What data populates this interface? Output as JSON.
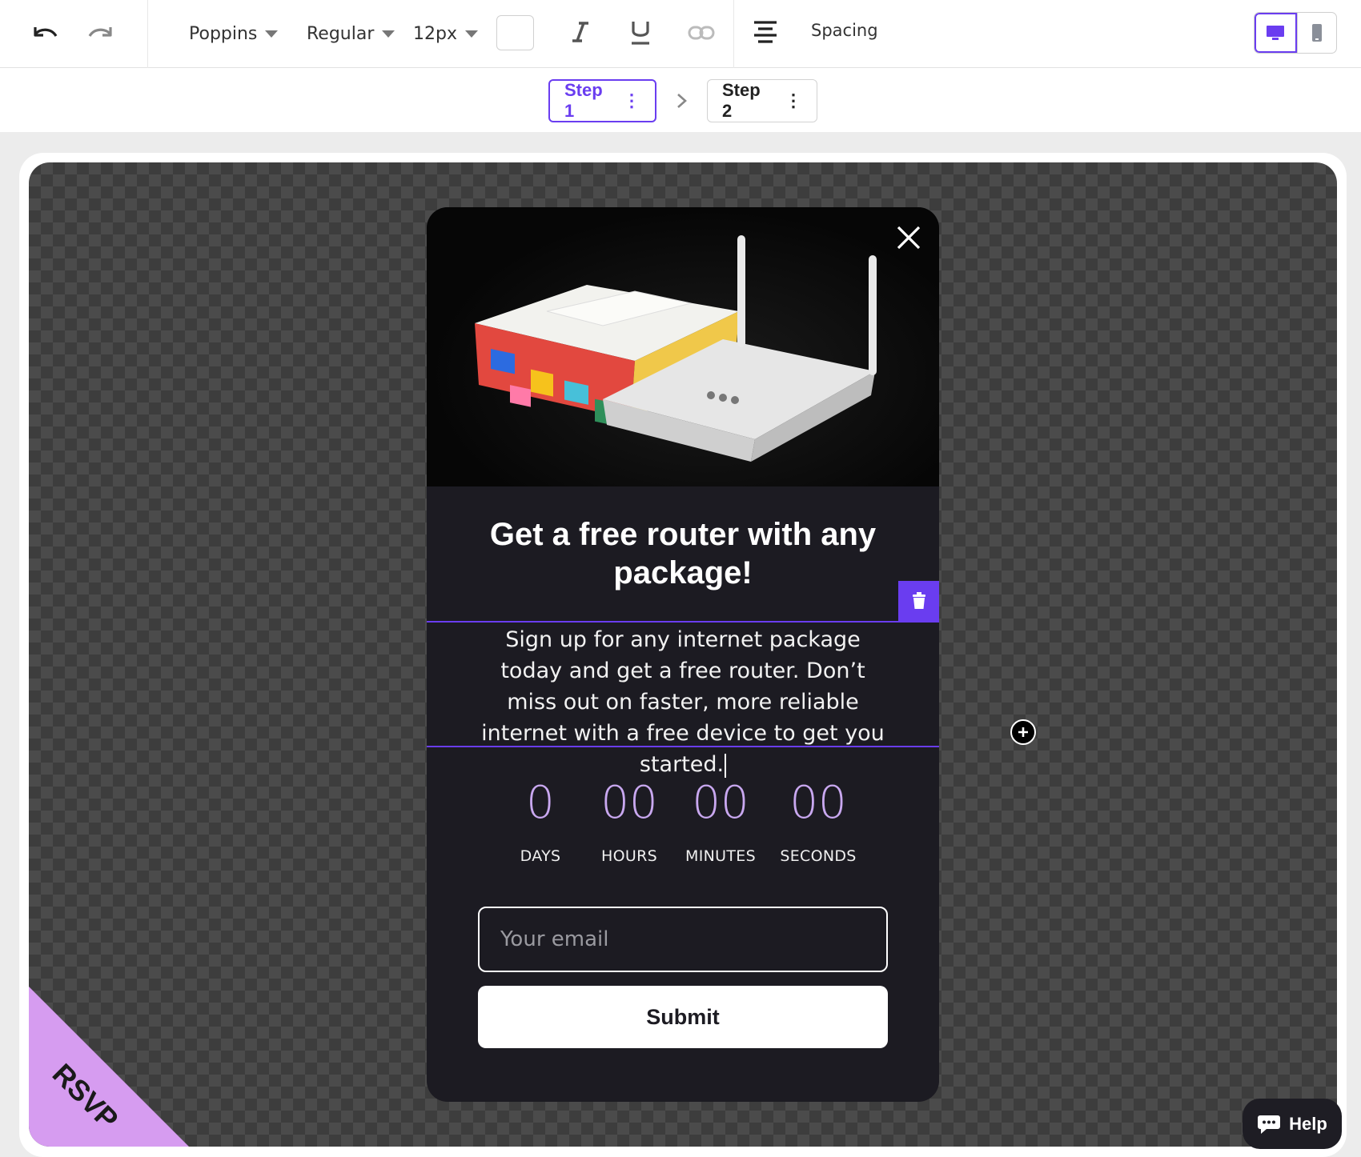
{
  "toolbar": {
    "font_family": "Poppins",
    "font_weight": "Regular",
    "font_size": "12px",
    "text_color": "#ffffff",
    "spacing_label": "Spacing",
    "device_active": "desktop"
  },
  "steps": [
    {
      "label": "Step 1",
      "active": true
    },
    {
      "label": "Step 2",
      "active": false
    }
  ],
  "popup": {
    "headline": "Get a free router with any package!",
    "body": "Sign up for any internet package today and get a free router. Don’t miss out on faster, more reliable internet with a free device to get you started.",
    "countdown": [
      {
        "value": "0",
        "label": "DAYS"
      },
      {
        "value": "00",
        "label": "HOURS"
      },
      {
        "value": "00",
        "label": "MINUTES"
      },
      {
        "value": "00",
        "label": "SECONDS"
      }
    ],
    "email_placeholder": "Your email",
    "submit_label": "Submit"
  },
  "corner_badge": "RSVP",
  "help_label": "Help",
  "colors": {
    "accent": "#6a3df0",
    "popup_bg": "#1c1b22",
    "countdown_digits": "#c9a8f0",
    "badge": "#d69cf0"
  }
}
